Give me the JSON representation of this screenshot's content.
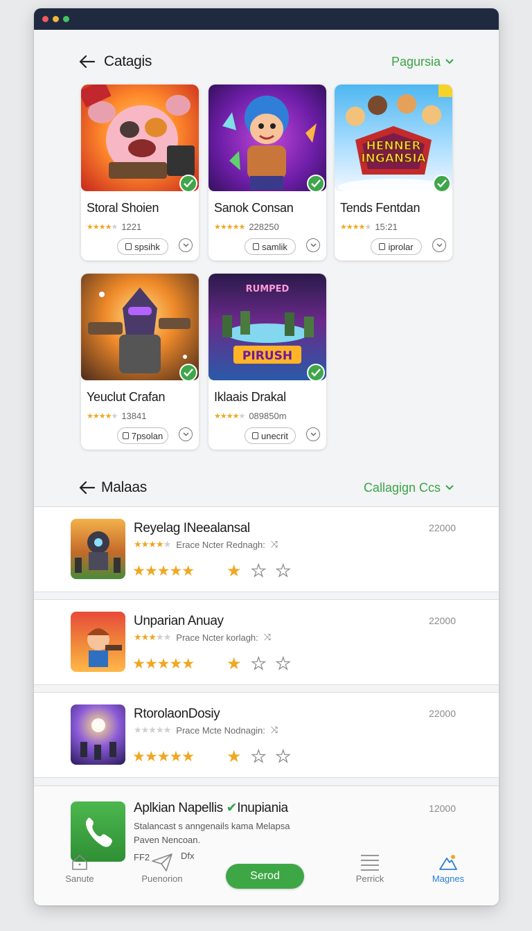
{
  "colors": {
    "accent": "#3aa347",
    "star": "#f0a722",
    "titlebar": "#1f2a40"
  },
  "top_section": {
    "title": "Catagis",
    "filter": "Pagursia"
  },
  "cards": [
    {
      "name": "Storal Shoien",
      "stars": 4,
      "rating": "1221",
      "button": "spsihk",
      "image": "pig-game-art"
    },
    {
      "name": "Sanok Consan",
      "stars": 5,
      "rating": "228250",
      "button": "samlik",
      "image": "hero-boy-art"
    },
    {
      "name": "Tends Fentdan",
      "stars": 4,
      "rating": "15:21",
      "button": "iprolar",
      "image": "heroes-banner-art",
      "image_text": "HENNER INGANSIA"
    },
    {
      "name": "Yeuclut Crafan",
      "stars": 4,
      "rating": "13841",
      "button": "7psolan",
      "image": "robot-warrior-art"
    },
    {
      "name": "Iklaais Drakal",
      "stars": 4,
      "rating": "089850m",
      "button": "unecrit",
      "image": "battle-arena-art"
    }
  ],
  "list_section": {
    "title": "Malaas",
    "filter": "Callagign Ccs"
  },
  "rows": [
    {
      "name": "Reyelag INeealansal",
      "stars": 4,
      "subtitle": "Erace Ncter Rednagh:",
      "price": "22000",
      "image": "mech-battle-icon"
    },
    {
      "name": "Unparian Anuay",
      "stars": 3,
      "subtitle": "Prace Ncter korlagh:",
      "price": "22000",
      "image": "kid-hero-icon"
    },
    {
      "name": "RtorolaonDosiy",
      "stars": 0,
      "subtitle": "Prace Mcte  Nodnagin:",
      "price": "22000",
      "image": "space-battle-icon"
    }
  ],
  "last_row": {
    "name": "Aplkian Napellis",
    "tag": "Inupiania",
    "desc_line1": "Stalancast s anngenails kama Melapsa",
    "desc_line2": "Paven Nencoan.",
    "price": "12000",
    "small1": "FF2",
    "small2": "Dfx"
  },
  "nav": {
    "home": "Sanute",
    "promo": "Puenorion",
    "send": "Serod",
    "list": "Perrick",
    "magnes": "Magnes"
  }
}
